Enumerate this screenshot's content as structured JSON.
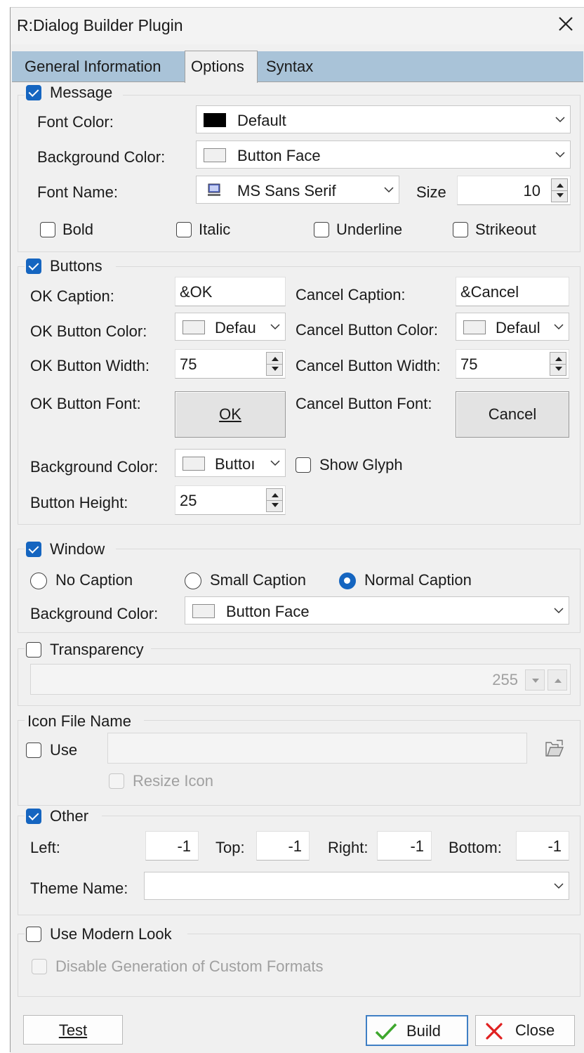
{
  "window": {
    "title": "R:Dialog Builder Plugin"
  },
  "tabs": [
    "General Information",
    "Options",
    "Syntax"
  ],
  "message": {
    "legend": "Message",
    "checked": true,
    "font_color_label": "Font Color:",
    "font_color_value": "Default",
    "bg_color_label": "Background Color:",
    "bg_color_value": "Button Face",
    "font_name_label": "Font Name:",
    "font_name_value": "MS Sans Serif",
    "size_label": "Size",
    "size_value": "10",
    "bold": "Bold",
    "italic": "Italic",
    "underline": "Underline",
    "strikeout": "Strikeout"
  },
  "buttons": {
    "legend": "Buttons",
    "checked": true,
    "ok_caption_label": "OK Caption:",
    "ok_caption_value": "&OK",
    "cancel_caption_label": "Cancel Caption:",
    "cancel_caption_value": "&Cancel",
    "ok_color_label": "OK Button Color:",
    "ok_color_value": "Defau",
    "cancel_color_label": "Cancel Button Color:",
    "cancel_color_value": "Defaul",
    "ok_width_label": "OK Button Width:",
    "ok_width_value": "75",
    "cancel_width_label": "Cancel Button Width:",
    "cancel_width_value": "75",
    "ok_font_label": "OK Button  Font:",
    "ok_font_button": "OK",
    "cancel_font_label": "Cancel Button  Font:",
    "cancel_font_button": "Cancel",
    "bg_color_label": "Background Color:",
    "bg_color_value": "Buttoı",
    "show_glyph": "Show Glyph",
    "height_label": "Button Height:",
    "height_value": "25"
  },
  "window_group": {
    "legend": "Window",
    "checked": true,
    "no_caption": "No Caption",
    "small_caption": "Small Caption",
    "normal_caption": "Normal Caption",
    "selected": "Normal Caption",
    "bg_color_label": "Background Color:",
    "bg_color_value": "Button Face"
  },
  "transparency": {
    "legend": "Transparency",
    "checked": false,
    "value": "255"
  },
  "icon": {
    "legend": "Icon File Name",
    "use": "Use",
    "path": "",
    "resize": "Resize Icon"
  },
  "other": {
    "legend": "Other",
    "checked": true,
    "left_label": "Left:",
    "left_value": "-1",
    "top_label": "Top:",
    "top_value": "-1",
    "right_label": "Right:",
    "right_value": "-1",
    "bottom_label": "Bottom:",
    "bottom_value": "-1",
    "theme_label": "Theme Name:",
    "theme_value": ""
  },
  "modern": {
    "legend": "Use Modern Look",
    "disable_custom": "Disable Generation of Custom Formats"
  },
  "footer": {
    "test": "Test",
    "build": "Build",
    "close": "Close"
  },
  "colors": {
    "accent": "#1565c0",
    "tab_strip": "#a9c3d8",
    "dialog_bg": "#f0f0f0",
    "build_check": "#3ea72d",
    "close_x": "#e02020"
  }
}
